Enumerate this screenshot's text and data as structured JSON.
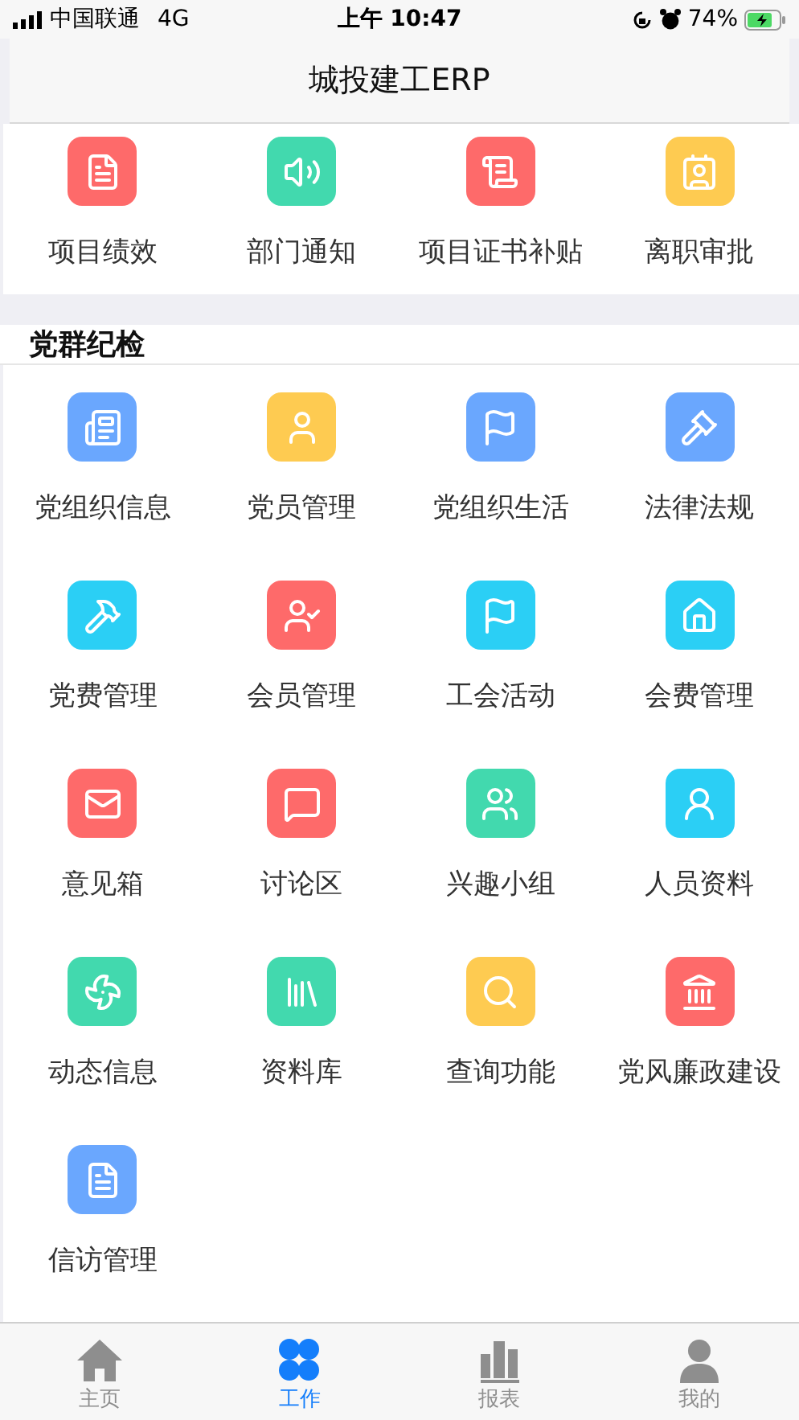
{
  "status_bar": {
    "carrier": "中国联通",
    "network": "4G",
    "time": "上午 10:47",
    "battery": "74%"
  },
  "nav_bar": {
    "title": "城投建工ERP"
  },
  "top_section": {
    "items": [
      {
        "label": "项目绩效",
        "color": "#fe6a6a"
      },
      {
        "label": "部门通知",
        "color": "#42d9ae"
      },
      {
        "label": "项目证书补贴",
        "color": "#fe6a6a"
      },
      {
        "label": "离职审批",
        "color": "#fecb51"
      }
    ]
  },
  "party_section": {
    "title": "党群纪检",
    "items": [
      {
        "label": "党组织信息",
        "color": "#6aa7fe"
      },
      {
        "label": "党员管理",
        "color": "#fecb51"
      },
      {
        "label": "党组织生活",
        "color": "#6aa7fe"
      },
      {
        "label": "法律法规",
        "color": "#6aa7fe"
      },
      {
        "label": "党费管理",
        "color": "#2bcff5"
      },
      {
        "label": "会员管理",
        "color": "#fe6a6a"
      },
      {
        "label": "工会活动",
        "color": "#2bcff5"
      },
      {
        "label": "会费管理",
        "color": "#2bcff5"
      },
      {
        "label": "意见箱",
        "color": "#fe6a6a"
      },
      {
        "label": "讨论区",
        "color": "#fe6a6a"
      },
      {
        "label": "兴趣小组",
        "color": "#42d9ae"
      },
      {
        "label": "人员资料",
        "color": "#2bcff5"
      },
      {
        "label": "动态信息",
        "color": "#42d9ae"
      },
      {
        "label": "资料库",
        "color": "#42d9ae"
      },
      {
        "label": "查询功能",
        "color": "#fecb51"
      },
      {
        "label": "党风廉政建设",
        "color": "#fe6a6a"
      },
      {
        "label": "信访管理",
        "color": "#6aa7fe"
      }
    ]
  },
  "tab_bar": {
    "tabs": [
      {
        "label": "主页",
        "selected": false
      },
      {
        "label": "工作",
        "selected": true
      },
      {
        "label": "报表",
        "selected": false
      },
      {
        "label": "我的",
        "selected": false
      }
    ]
  }
}
